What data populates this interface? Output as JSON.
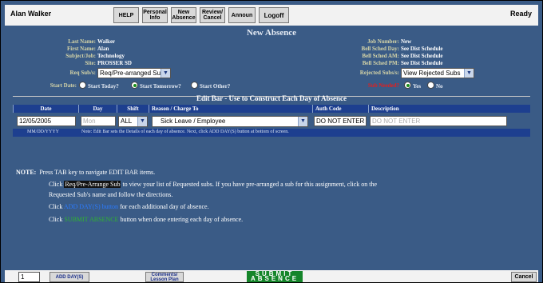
{
  "top": {
    "user": "Alan Walker",
    "buttons": [
      "HELP",
      "Personal Info",
      "New Absence",
      "Review/ Cancel",
      "Announ",
      "Logoff"
    ],
    "status": "Ready"
  },
  "page_title": "New Absence",
  "info_left": [
    {
      "label": "Last Name:",
      "value": "Walker"
    },
    {
      "label": "First Name:",
      "value": "Alan"
    },
    {
      "label": "Subject/Job:",
      "value": "Technology"
    },
    {
      "label": "Site:",
      "value": "PROSSER SD"
    }
  ],
  "info_right": [
    {
      "label": "Job Number:",
      "value": "New"
    },
    {
      "label": "Bell Sched Day:",
      "value": "See Dist Schedule"
    },
    {
      "label": "Bell Sched AM:",
      "value": "See Dist Schedule"
    },
    {
      "label": "Bell Sched PM:",
      "value": "See Dist Schedule"
    }
  ],
  "req_subs": {
    "label": "Req Sub/s:",
    "value": "Req/Pre-arranged Sub"
  },
  "rejected_subs": {
    "label": "Rejected Subs/s:",
    "value": "View Rejected Subs"
  },
  "start_date": {
    "label": "Start Date:",
    "options": [
      "Start Today?",
      "Start Tomorrow?",
      "Start Other?"
    ],
    "selected": 1
  },
  "sub_needed": {
    "label": "Sub Needed?",
    "options": [
      "Yes",
      "No"
    ],
    "selected": 0
  },
  "edit_bar": {
    "title": "Edit Bar - Use to Construct Each Day of Absence",
    "headers": [
      "Date",
      "Day",
      "Shift",
      "Reason / Charge To",
      "Auth Code",
      "Description"
    ],
    "date": "12/05/2005",
    "day_placeholder": "Mon",
    "shift": "ALL",
    "reason": "Sick Leave / Employee",
    "auth_code": "DO NOT ENTER",
    "description_placeholder": "DO NOT ENTER",
    "date_format": "MM/DD/YYYY",
    "note": "Note: Edit Bar sets the Details of each day of absence. Next, click ADD DAY(S) button at bottom of screen."
  },
  "instructions": {
    "note_label": "NOTE:",
    "line1": "Press TAB key to navigate EDIT BAR items.",
    "line2_pre": "Click",
    "line2_chip": "Req/Pre-Arrange Sub",
    "line2_post": "to view your list of Requested subs. If you have pre-arranged a sub for this assignment, click on the",
    "line3": "Requested Sub's name and follow the directions.",
    "line4_pre": "Click",
    "line4_link": "ADD DAY(S) button",
    "line4_post": "for each additional day of absence.",
    "line5_pre": "Click",
    "line5_link": "SUBMIT ABSENCE",
    "line5_post": "button when done entering each day of absence."
  },
  "bottom": {
    "day_count": "1",
    "add_day": "ADD DAY(S)",
    "comments_line1": "Comments/",
    "comments_line2": "Lesson Plan",
    "submit_line1": "SUBMIT",
    "submit_line2": "ABSENCE",
    "cancel": "Cancel"
  },
  "colors": {
    "background": "#3a5b86",
    "header_blue": "#1d3f8f",
    "label": "#d7d6a8",
    "submit_green": "#15852a",
    "link_blue": "#2b7bff"
  }
}
